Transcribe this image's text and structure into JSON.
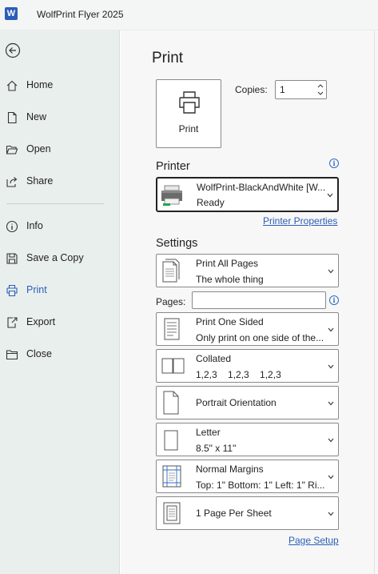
{
  "window": {
    "title": "WolfPrint Flyer 2025",
    "app_icon_letter": "W"
  },
  "sidebar": {
    "items": [
      {
        "label": "Home"
      },
      {
        "label": "New"
      },
      {
        "label": "Open"
      },
      {
        "label": "Share"
      },
      {
        "label": "Info"
      },
      {
        "label": "Save a Copy"
      },
      {
        "label": "Print"
      },
      {
        "label": "Export"
      },
      {
        "label": "Close"
      }
    ],
    "active": "Print"
  },
  "main": {
    "heading": "Print",
    "print_button_label": "Print",
    "copies_label": "Copies:",
    "copies_value": "1",
    "printer": {
      "heading": "Printer",
      "name": "WolfPrint-BlackAndWhite [W...",
      "status": "Ready",
      "properties_link": "Printer Properties"
    },
    "settings": {
      "heading": "Settings",
      "print_range": {
        "title": "Print All Pages",
        "subtitle": "The whole thing"
      },
      "pages_label": "Pages:",
      "pages_value": "",
      "sides": {
        "title": "Print One Sided",
        "subtitle": "Only print on one side of the..."
      },
      "collation": {
        "title": "Collated",
        "subtitle": "1,2,3    1,2,3    1,2,3"
      },
      "orientation": {
        "title": "Portrait Orientation"
      },
      "paper": {
        "title": "Letter",
        "subtitle": "8.5\" x 11\""
      },
      "margins": {
        "title": "Normal Margins",
        "subtitle": "Top: 1\" Bottom: 1\" Left: 1\" Ri..."
      },
      "per_sheet": {
        "title": "1 Page Per Sheet"
      },
      "page_setup_link": "Page Setup"
    }
  },
  "colors": {
    "accent": "#2b5eb8",
    "sidebar_bg": "#e9efec",
    "link": "#2b5eb8"
  }
}
